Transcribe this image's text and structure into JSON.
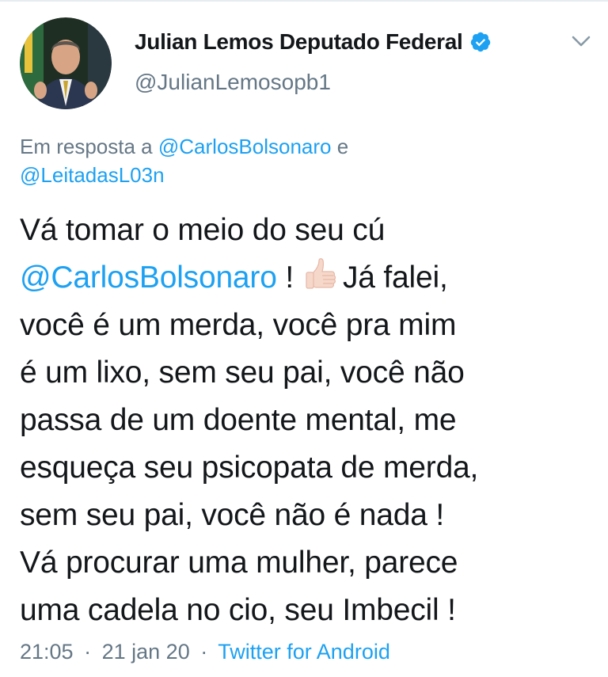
{
  "author": {
    "display_name": "Julian Lemos Deputado Federal",
    "handle": "@JulianLemosopb1",
    "verified": true,
    "avatar_icon": "profile-photo"
  },
  "reply_context": {
    "prefix": "Em resposta a",
    "mention1": "@CarlosBolsonaro",
    "connector": "e",
    "mention2": "@LeitadasL03n"
  },
  "tweet": {
    "line1": "Vá tomar o meio do seu cú",
    "mention": "@CarlosBolsonaro",
    "after_mention": " !",
    "emoji_icon": "thumbs-up-emoji",
    "line2_rest": "Já falei,",
    "line3": "você é um merda, você pra mim",
    "line4": "é um lixo, sem seu pai, você não",
    "line5": "passa de um doente mental, me",
    "line6": "esqueça seu psicopata de merda,",
    "line7": "sem seu pai, você não é nada !",
    "line8": "Vá procurar uma mulher, parece",
    "line9": "uma cadela no cio, seu Imbecil !"
  },
  "meta": {
    "time": "21:05",
    "separator": "·",
    "date": "21 jan 20",
    "source": "Twitter for Android"
  },
  "colors": {
    "link": "#1da1f2",
    "secondary_text": "#657786",
    "primary_text": "#14171a"
  }
}
